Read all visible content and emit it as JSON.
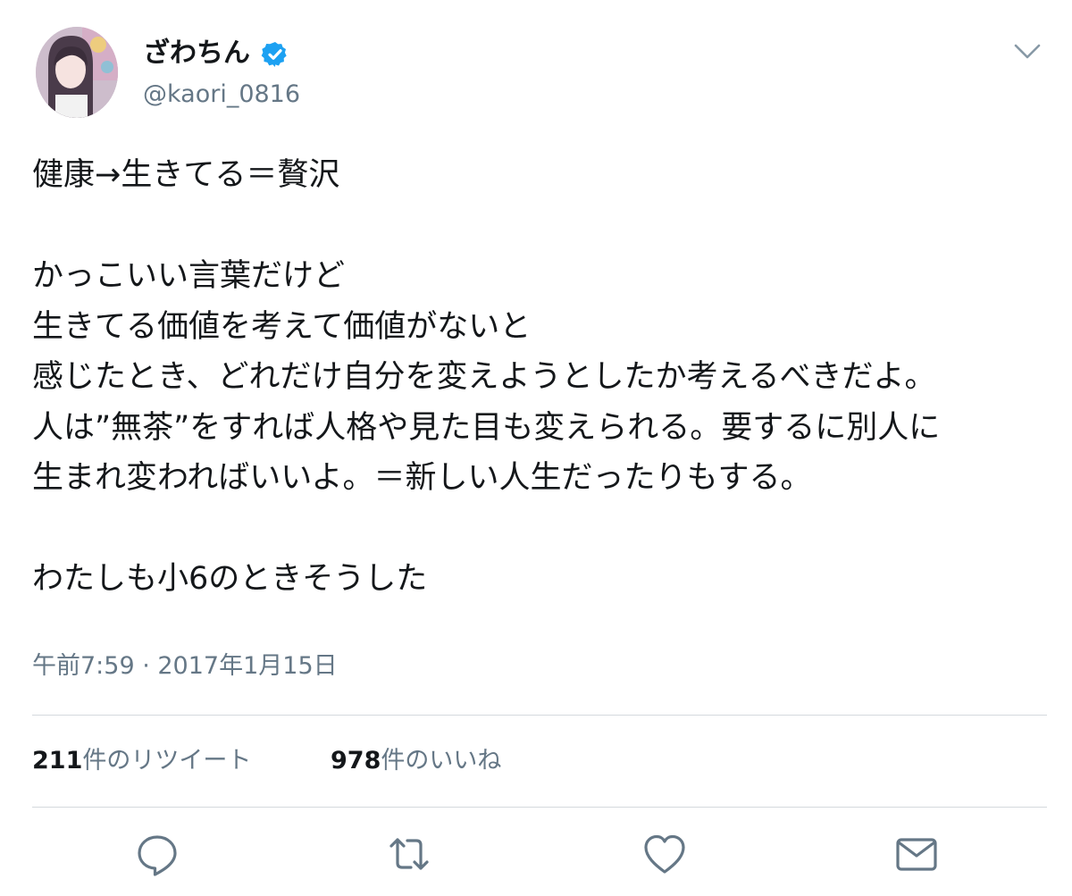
{
  "tweet": {
    "author": {
      "display_name": "ざわちん",
      "handle": "@kaori_0816",
      "verified": true
    },
    "lines": [
      "健康→生きてる＝贅沢",
      "",
      "かっこいい言葉だけど",
      "生きてる価値を考えて価値がないと",
      "感じたとき、どれだけ自分を変えようとしたか考えるべきだよ。",
      "人は”無茶”をすれば人格や見た目も変えられる。要するに別人に",
      "生まれ変わればいいよ。＝新しい人生だったりもする。",
      "",
      "わたしも小6のときそうした"
    ],
    "timestamp": "午前7:59 · 2017年1月15日",
    "stats": {
      "retweet_count": "211",
      "retweet_label": "件のリツイート",
      "like_count": "978",
      "like_label": "件のいいね"
    }
  },
  "icons": {
    "verified": "verified-badge-icon",
    "menu": "chevron-down-icon",
    "reply": "reply-bubble-icon",
    "retweet": "retweet-arrows-icon",
    "like": "heart-icon",
    "dm": "envelope-icon"
  },
  "colors": {
    "verified_blue": "#1da1f2",
    "secondary_text": "#657786",
    "primary_text": "#14171a",
    "divider": "#d4d9dd"
  }
}
